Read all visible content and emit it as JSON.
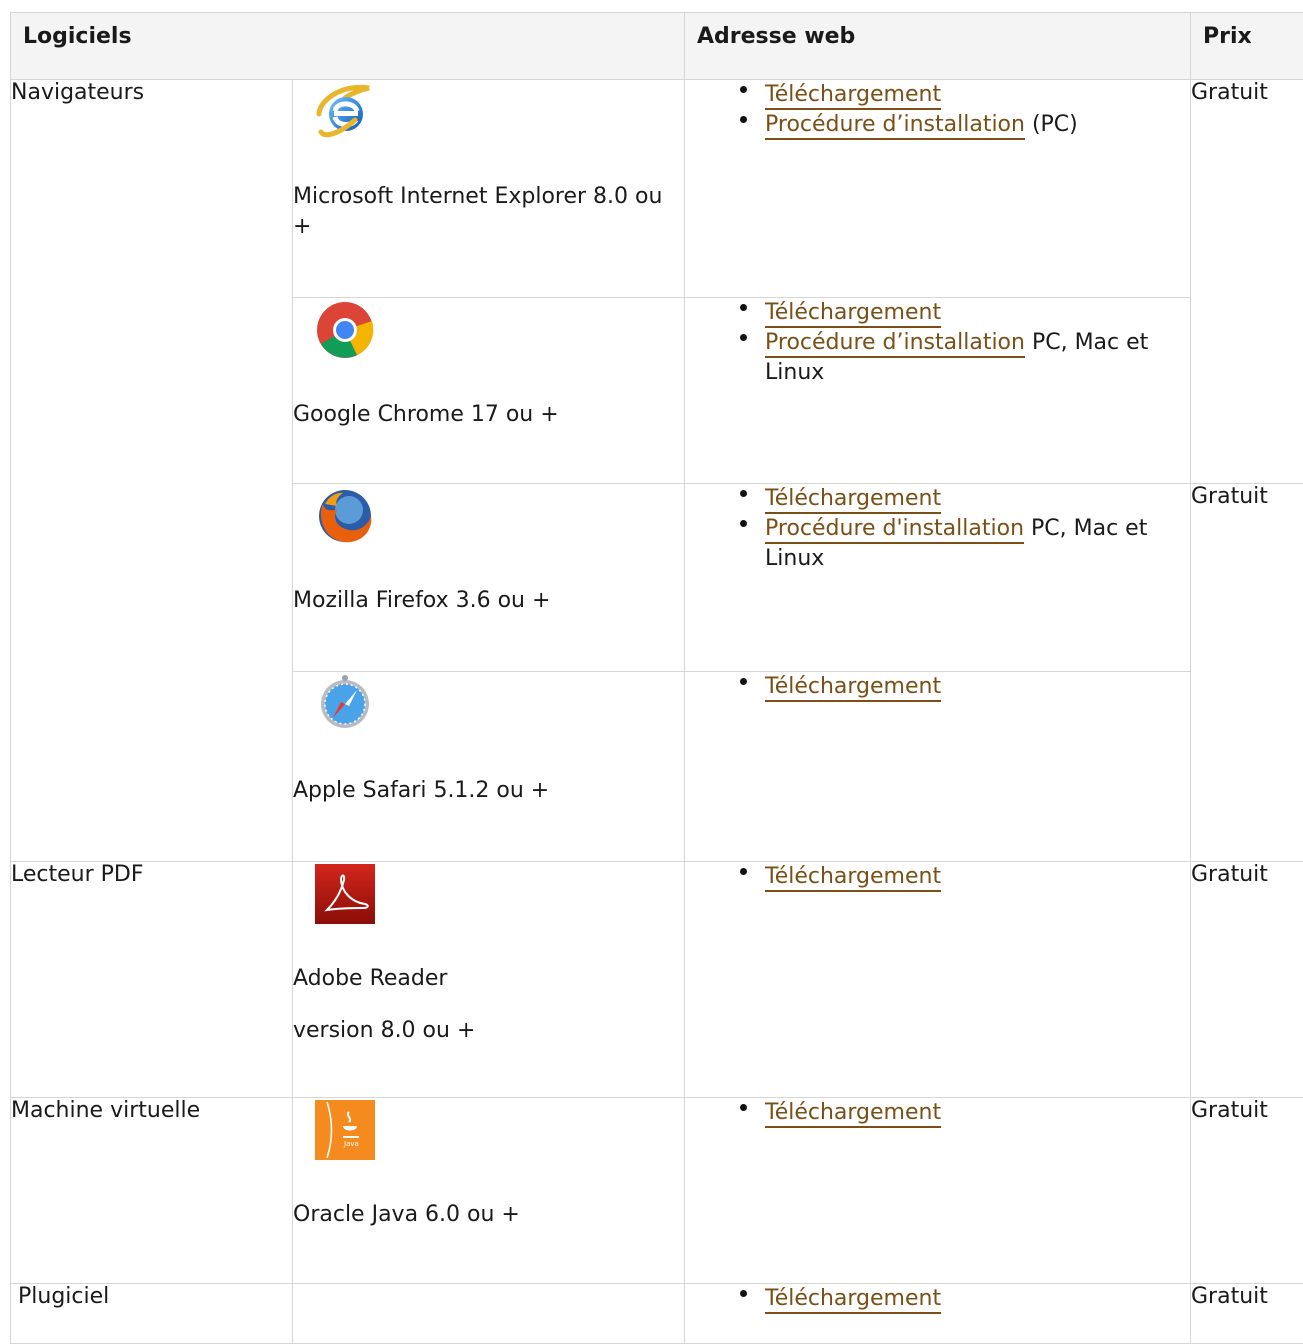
{
  "table": {
    "headers": {
      "software": "Logiciels",
      "web": "Adresse web",
      "price": "Prix"
    },
    "categories": {
      "browsers": "Navigateurs",
      "pdf": "Lecteur PDF",
      "vm": "Machine virtuelle",
      "plugin": " Plugiciel"
    },
    "rows": {
      "ie": {
        "name": "Microsoft Internet Explorer 8.0 ou +",
        "download": "Téléchargement",
        "install": "Procédure d’installation",
        "install_suffix": " (PC)",
        "price": "Gratuit",
        "icon": "internet-explorer-icon"
      },
      "chrome": {
        "name": "Google Chrome 17 ou +",
        "download": "Téléchargement",
        "install": "Procédure d’installation",
        "install_suffix": " PC, Mac et Linux",
        "icon": "chrome-icon"
      },
      "firefox": {
        "name": " Mozilla Firefox 3.6 ou +",
        "download": "Téléchargement",
        "install": "Procédure d'installation",
        "install_suffix": " PC, Mac et Linux",
        "price": "Gratuit",
        "icon": "firefox-icon"
      },
      "safari": {
        "name": "Apple Safari 5.1.2 ou +",
        "download": "Téléchargement",
        "icon": "safari-icon"
      },
      "adobe": {
        "name": "Adobe Reader",
        "version": "version 8.0 ou +",
        "download": "Téléchargement",
        "price": "Gratuit",
        "icon": "adobe-reader-icon"
      },
      "java": {
        "name": "Oracle Java 6.0 ou +",
        "download": "Téléchargement",
        "price": "Gratuit",
        "icon": "java-icon"
      },
      "plugin": {
        "download": "Téléchargement",
        "price": "Gratuit"
      }
    },
    "colors": {
      "link": "#7a5017",
      "header_bg": "#f4f4f4",
      "border": "#d6d6d6"
    }
  }
}
